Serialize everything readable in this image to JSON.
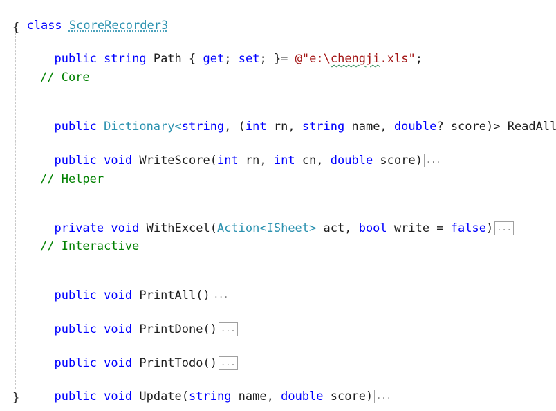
{
  "editor": {
    "class_decl": {
      "kw": "class",
      "name": "ScoreRecorder3"
    },
    "open_brace": "{",
    "close_brace": "}",
    "path_line": {
      "kw1": "public",
      "kw2": "string",
      "name": "Path",
      "open": " {",
      "get": "get",
      "semi1": ";",
      "set": "set",
      "semi2": ";",
      "close": " }=",
      "str_prefix": "@\"e:\\",
      "str_word": "chengji",
      "str_suffix": ".xls\"",
      "end": ";"
    },
    "comment_core": "// Core",
    "readall": {
      "kw1": "public",
      "type": "Dictionary<",
      "kw2": "string",
      "sep": ",",
      "open": " (",
      "kw3": "int",
      "p1": " rn,",
      "kw4": "string",
      "p2": " name,",
      "kw5": "double",
      "p3": "? score)> ReadAll()"
    },
    "writescore": {
      "kw1": "public",
      "kw2": "void",
      "name": "WriteScore(",
      "kw3": "int",
      "p1": " rn, ",
      "kw4": "int",
      "p2": " cn, ",
      "kw5": "double",
      "p3": " score)",
      "collapsed": "..."
    },
    "comment_helper": "// Helper",
    "withexcel": {
      "kw1": "private",
      "kw2": "void",
      "name": "WithExcel(",
      "type1": "Action<",
      "type2": "ISheet",
      "type3": ">",
      "p1": " act, ",
      "kw3": "bool",
      "p2": " write = ",
      "kw4": "false",
      "p3": ")",
      "collapsed": "..."
    },
    "comment_interactive": "// Interactive",
    "printall": {
      "kw1": "public",
      "kw2": "void",
      "name": "PrintAll()",
      "collapsed": "..."
    },
    "printdone": {
      "kw1": "public",
      "kw2": "void",
      "name": "PrintDone()",
      "collapsed": "..."
    },
    "printtodo": {
      "kw1": "public",
      "kw2": "void",
      "name": "PrintTodo()",
      "collapsed": "..."
    },
    "update": {
      "kw1": "public",
      "kw2": "void",
      "name": "Update(",
      "kw3": "string",
      "p1": " name, ",
      "kw4": "double",
      "p2": " score)",
      "collapsed": "..."
    },
    "colors": {
      "keyword": "#0000ff",
      "type": "#2b91af",
      "comment": "#008000",
      "string": "#a31515"
    }
  }
}
